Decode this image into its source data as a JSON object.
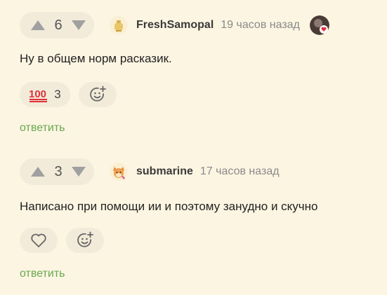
{
  "comments": [
    {
      "votes": "6",
      "username": "FreshSamopal",
      "timestamp": "19 часов назад",
      "text": "Ну в общем норм расказик.",
      "reaction_emoji": "💯",
      "reaction_count": "3",
      "reply_label": "ответить"
    },
    {
      "votes": "3",
      "username": "submarine",
      "timestamp": "17 часов назад",
      "text": "Написано при помощи ии и поэтому занудно и скучно",
      "reply_label": "ответить"
    }
  ],
  "colors": {
    "background": "#fcf5e2",
    "pill": "#f2ebd9",
    "reply_link": "#6aa84f",
    "vote_arrow": "#a0a0a0"
  },
  "icons": {
    "upvote": "triangle-up-icon",
    "downvote": "triangle-down-icon",
    "add_reaction": "smiley-plus-icon",
    "like": "heart-icon",
    "hundred": "hundred-points-icon"
  }
}
